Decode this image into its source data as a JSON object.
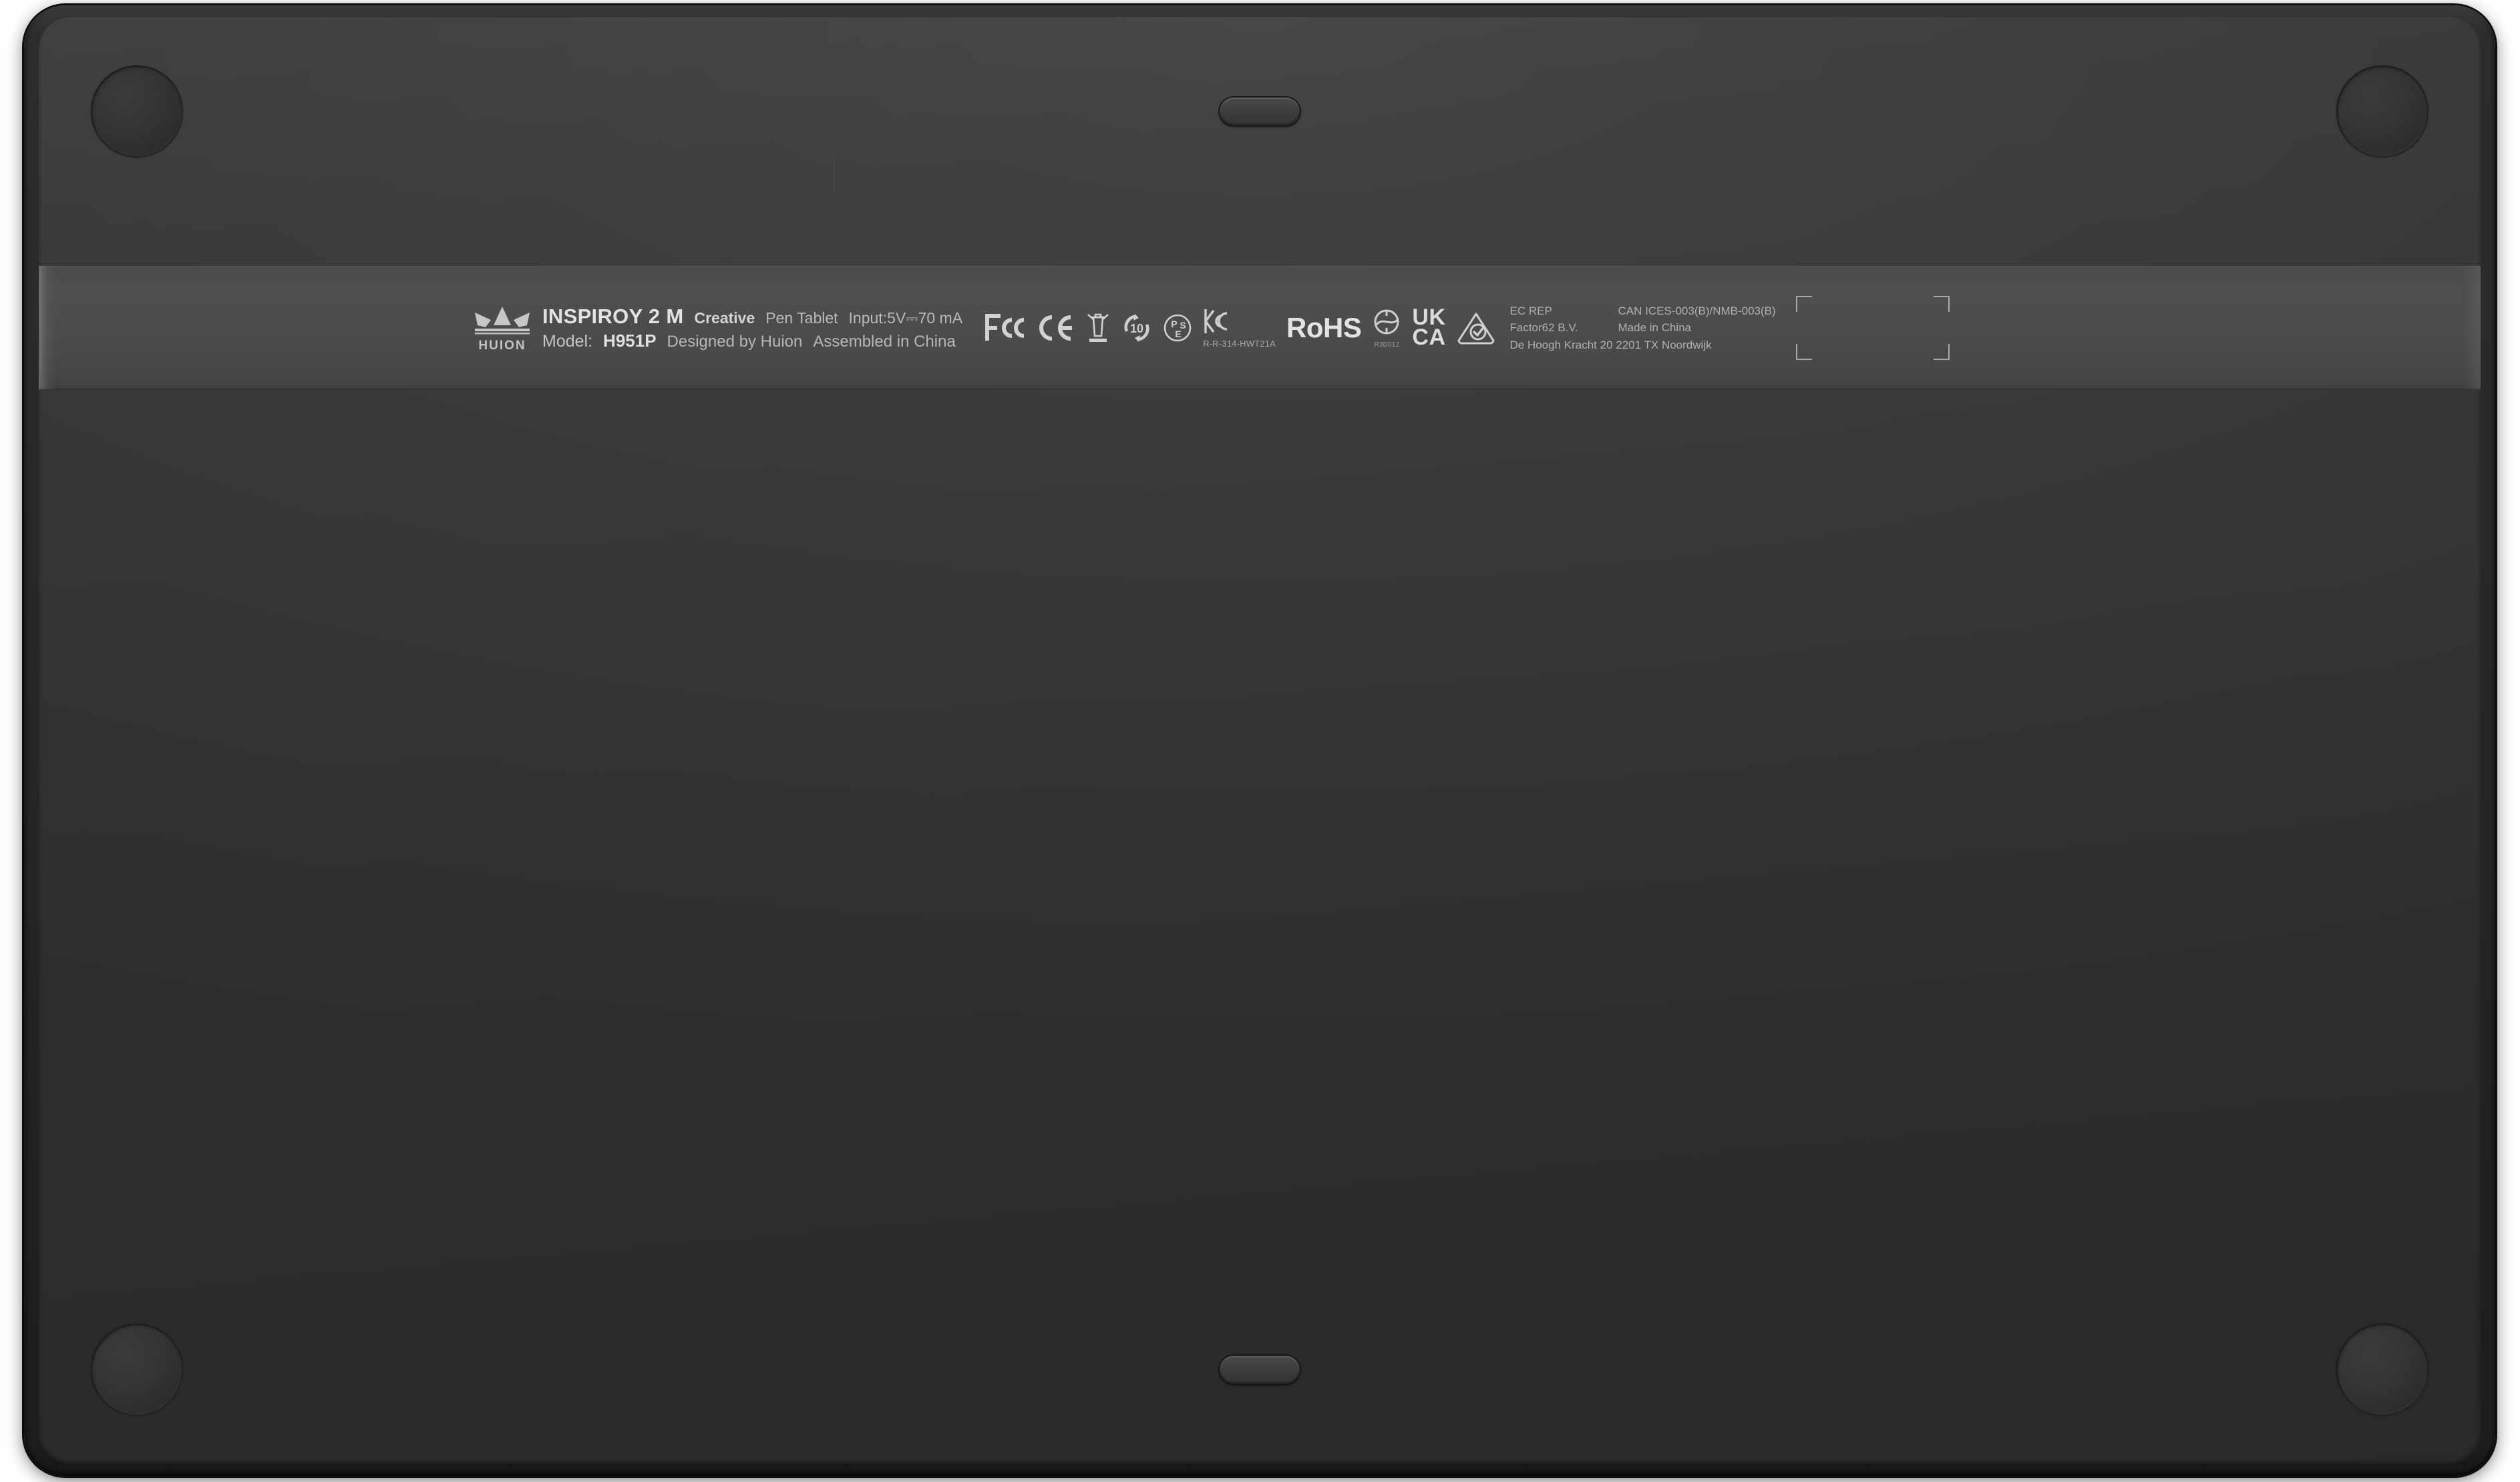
{
  "device": {
    "brand": "HUION",
    "product_name": "INSPIROY 2 M",
    "product_type_strong": "Creative",
    "product_type": "Pen Tablet",
    "input_spec": "Input:5V⎓70 mA",
    "model_label": "Model:",
    "model_value": "H951P",
    "designed_by": "Designed by Huion",
    "assembled_in": "Assembled in China",
    "body_color": "#333333",
    "label_band_color": "#4c4c4c",
    "text_color": "#c9c9c9"
  },
  "certifications": [
    {
      "id": "fcc",
      "name": "FCC",
      "label": "FCC"
    },
    {
      "id": "ce",
      "name": "CE",
      "label": "CE"
    },
    {
      "id": "weee",
      "name": "WEEE",
      "label": "crossed-out-wheelie-bin"
    },
    {
      "id": "china-rohs",
      "name": "China RoHS EPUP",
      "label": "10"
    },
    {
      "id": "pse",
      "name": "PSE",
      "label": "PSE"
    },
    {
      "id": "kc",
      "name": "KC",
      "label": "KC",
      "code": "R-R-314-HWT21A"
    },
    {
      "id": "rohs",
      "name": "RoHS",
      "label": "RoHS"
    },
    {
      "id": "bsmi",
      "name": "BSMI",
      "label": "bsmi-mark",
      "code": "R3D012"
    },
    {
      "id": "ukca",
      "name": "UKCA",
      "label_line1": "UK",
      "label_line2": "CA"
    },
    {
      "id": "rcm",
      "name": "RCM",
      "label": "regulatory-compliance-mark"
    }
  ],
  "regulatory": {
    "ec_rep_label": "EC REP",
    "ec_rep_company": "Factor62 B.V.",
    "ec_rep_address": "De Hoogh Kracht 20 2201 TX Noordwijk",
    "ices": "CAN ICES-003(B)/NMB-003(B)",
    "made_in": "Made in China"
  },
  "hardware": {
    "feet_count": 4,
    "grip_slots": [
      "top-center",
      "bottom-center"
    ]
  }
}
